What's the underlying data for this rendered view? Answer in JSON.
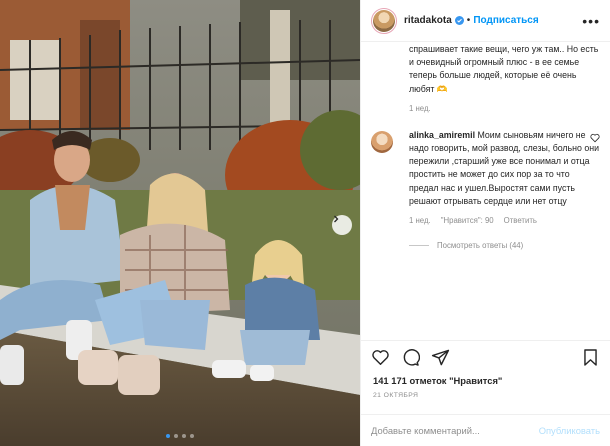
{
  "header": {
    "username": "ritadakota",
    "separator": "•",
    "follow_label": "Подписаться",
    "more_label": "•••",
    "verified_icon": "verified-badge-icon",
    "verified_color": "#3897f0"
  },
  "comments": {
    "first": {
      "text": "спрашивает такие вещи, чего уж там.. Но есть и очевидный огромный плюс - в ее семье теперь больше людей, которые её очень любят 🫶",
      "time": "1 нед."
    },
    "second": {
      "username": "alinka_amiremil",
      "text": "Моим сыновьям ничего не надо говорить, мой развод, слезы, больно они пережили ,старший уже все понимал и отца простить не может до сих пор за то что предал нас и ушел.Выростят сами пусть решают отрывать сердце или нет отцу",
      "time": "1 нед.",
      "likes": "\"Нравится\": 90",
      "reply_label": "Ответить"
    },
    "view_replies": "Посмотреть ответы (44)"
  },
  "actions": {
    "like_icon": "heart-icon",
    "comment_icon": "comment-icon",
    "share_icon": "share-icon",
    "save_icon": "bookmark-icon"
  },
  "likes_text": "141 171 отметок \"Нравится\"",
  "date": "21 ОКТЯБРЯ",
  "add_comment": {
    "placeholder": "Добавьте комментарий...",
    "publish_label": "Опубликовать",
    "publish_color": "#b2dffc"
  },
  "carousel": {
    "current_slide": 1,
    "total_slides": 4,
    "active_color": "#3897f0"
  }
}
